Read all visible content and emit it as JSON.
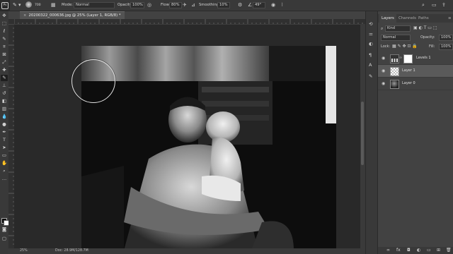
{
  "options_bar": {
    "logo": "Ps",
    "brush_size": "700",
    "mode_label": "Mode:",
    "mode_value": "Normal",
    "opacity_label": "Opacity:",
    "opacity_value": "100%",
    "flow_label": "Flow:",
    "flow_value": "80%",
    "smoothing_label": "Smoothing:",
    "smoothing_value": "10%",
    "angle_value": "49°"
  },
  "document": {
    "tab_title": "20200322_000636.jpg @ 25% (Layer 1, RGB/8) *",
    "close_glyph": "×"
  },
  "status": {
    "zoom": "25%",
    "doc": "Doc: 28.9M/128.7M"
  },
  "layers_panel": {
    "tabs": [
      "Layers",
      "Channels",
      "Paths"
    ],
    "kind_label": "Kind",
    "blend_mode": "Normal",
    "opacity_label": "Opacity:",
    "opacity_value": "100%",
    "lock_label": "Lock:",
    "fill_label": "Fill:",
    "fill_value": "100%",
    "layers": [
      {
        "name": "Levels 1",
        "type": "adjustment",
        "selected": false
      },
      {
        "name": "Layer 1",
        "type": "transparent",
        "selected": true
      },
      {
        "name": "Layer 0",
        "type": "photo",
        "selected": false
      }
    ]
  },
  "icons": {
    "toolbar": [
      "move-icon",
      "marquee-icon",
      "lasso-icon",
      "quick-select-icon",
      "crop-icon",
      "frame-icon",
      "eyedropper-icon",
      "healing-icon",
      "brush-icon",
      "clone-stamp-icon",
      "history-brush-icon",
      "eraser-icon",
      "gradient-icon",
      "blur-icon",
      "dodge-icon",
      "pen-icon",
      "type-icon",
      "path-select-icon",
      "shape-icon",
      "hand-icon",
      "zoom-icon",
      "more-tools-icon"
    ]
  },
  "colors": {
    "accent_selected_layer": "#5a5a5a",
    "panel_bg": "#424242",
    "app_bg": "#535353"
  }
}
